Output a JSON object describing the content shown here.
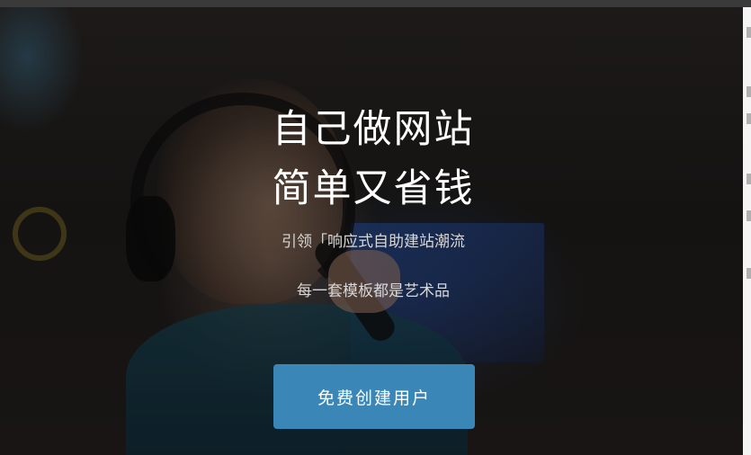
{
  "hero": {
    "title_line1": "自己做网站",
    "title_line2": "简单又省钱",
    "subtitle_line1": "引领「响应式自助建站潮流",
    "subtitle_line2": "每一套模板都是艺术品",
    "cta_label": "免费创建用户"
  },
  "colors": {
    "cta_background": "#3a86b6",
    "title_text": "#ffffff",
    "subtitle_text": "#d7d7d7"
  }
}
